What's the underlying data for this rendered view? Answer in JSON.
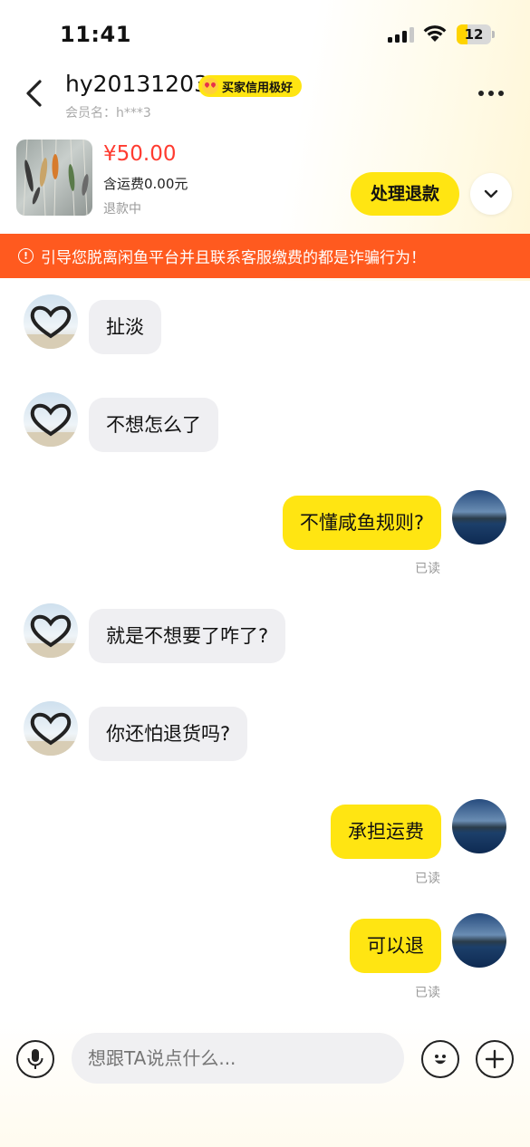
{
  "status_bar": {
    "time": "11:41",
    "battery": "12"
  },
  "header": {
    "username": "hy20131203",
    "credit_badge": "买家信用极好",
    "member_label": "会员名：h***3"
  },
  "product": {
    "price": "¥50.00",
    "shipping": "含运费0.00元",
    "status": "退款中",
    "action_label": "处理退款"
  },
  "warning": "引导您脱离闲鱼平台并且联系客服缴费的都是诈骗行为！",
  "messages": [
    {
      "side": "left",
      "text": "扯淡"
    },
    {
      "side": "left",
      "text": "不想怎么了"
    },
    {
      "side": "right",
      "text": "不懂咸鱼规则?",
      "status": "已读"
    },
    {
      "side": "left",
      "text": "就是不想要了咋了?"
    },
    {
      "side": "left",
      "text": "你还怕退货吗?"
    },
    {
      "side": "right",
      "text": "承担运费",
      "status": "已读"
    },
    {
      "side": "right",
      "text": "可以退",
      "status": "已读"
    }
  ],
  "input": {
    "placeholder": "想跟TA说点什么..."
  },
  "colors": {
    "accent": "#ffe512",
    "warning": "#ff5a1f",
    "price": "#ff3b30"
  }
}
